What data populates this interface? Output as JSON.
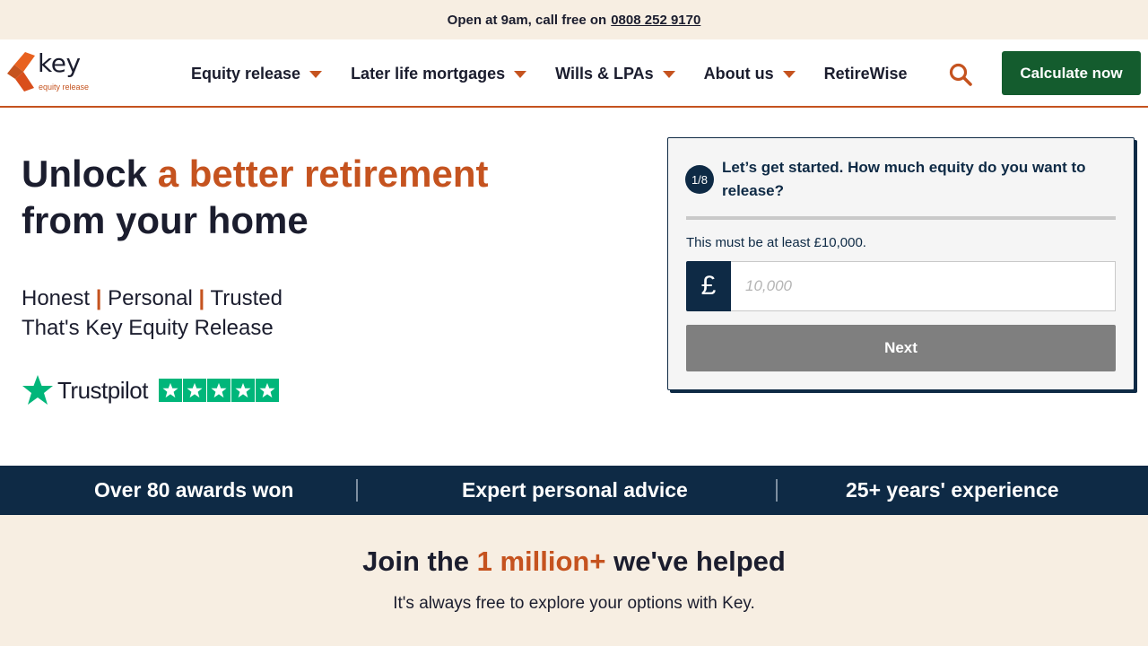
{
  "topbar": {
    "text": "Open at 9am, call free on",
    "phone": "0808 252 9170"
  },
  "brand": {
    "name": "key",
    "tagline": "equity release",
    "accent_color": "#c5531f",
    "navy_color": "#0e2a45",
    "cta_color": "#145c2e"
  },
  "nav": {
    "items": [
      {
        "label": "Equity release",
        "has_dropdown": true
      },
      {
        "label": "Later life mortgages",
        "has_dropdown": true
      },
      {
        "label": "Wills & LPAs",
        "has_dropdown": true
      },
      {
        "label": "About us",
        "has_dropdown": true
      },
      {
        "label": "RetireWise",
        "has_dropdown": false
      }
    ],
    "search_icon": "search-icon",
    "cta_label": "Calculate now"
  },
  "hero": {
    "title_part1": "Unlock ",
    "title_accent": "a better retirement",
    "title_part2": "from your home",
    "tag1": "Honest",
    "tag2": "Personal",
    "tag3": "Trusted",
    "tag_separator": "|",
    "tagline": "That's Key Equity Release",
    "trustpilot": {
      "name": "Trustpilot",
      "rating_stars": 5,
      "star_color": "#00b67a"
    }
  },
  "quiz": {
    "step": "1/8",
    "question": "Let’s get started. How much equity do you want to release?",
    "progress": 0,
    "hint": "This must be at least £10,000.",
    "currency_symbol": "£",
    "amount_placeholder": "10,000",
    "amount_value": "",
    "next_label": "Next"
  },
  "stats": [
    {
      "label": "Over 80 awards won"
    },
    {
      "label": "Expert personal advice"
    },
    {
      "label": "25+ years' experience"
    }
  ],
  "join": {
    "title_part1": "Join the ",
    "title_accent": "1 million+",
    "title_part2": " we've helped",
    "subtitle": "It's always free to explore your options with Key."
  }
}
